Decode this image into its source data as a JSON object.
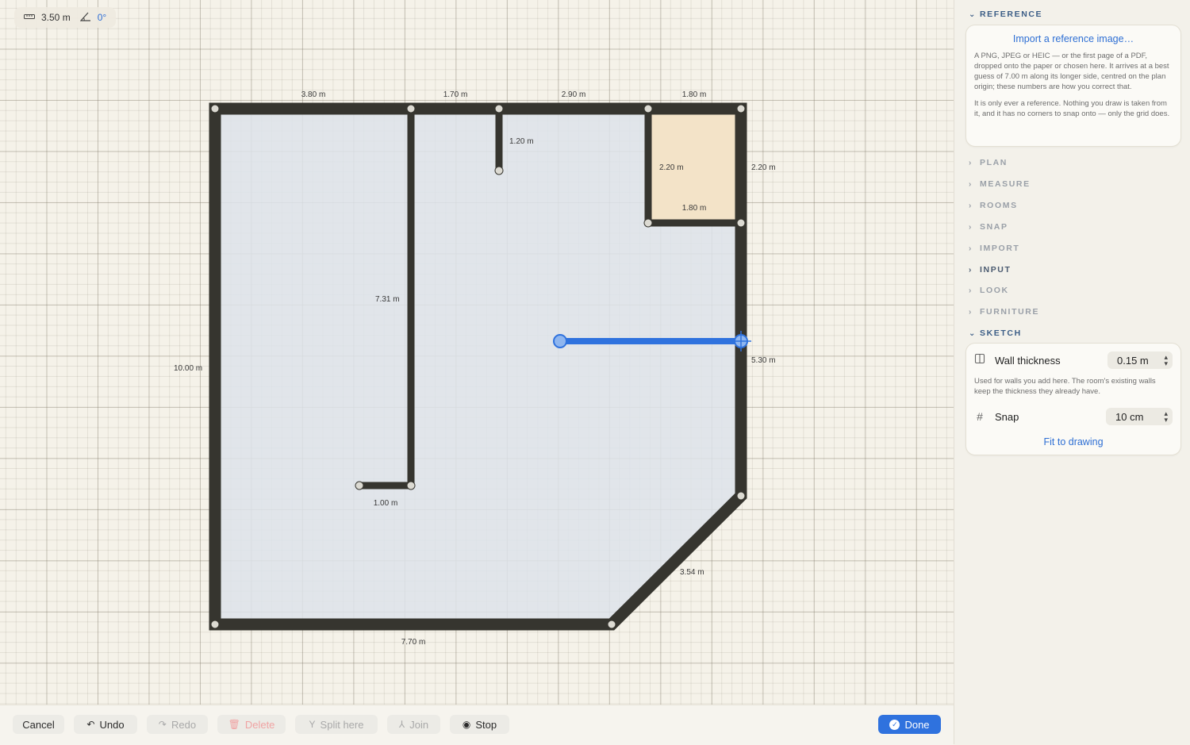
{
  "measure": {
    "length": "3.50 m",
    "angle": "0°"
  },
  "dimensions": {
    "top_1": "3.80 m",
    "top_2": "1.70 m",
    "top_3": "2.90 m",
    "top_4": "1.80 m",
    "stub": "1.20 m",
    "closet_height": "2.20 m",
    "right_upper": "2.20 m",
    "closet_width": "1.80 m",
    "inner_wall": "7.31 m",
    "left": "10.00 m",
    "right_lower": "5.30 m",
    "short_wall": "1.00 m",
    "diagonal": "3.54 m",
    "bottom": "7.70 m"
  },
  "sidebar": {
    "reference": {
      "title": "REFERENCE",
      "import_link": "Import a reference image…",
      "note1": "A PNG, JPEG or HEIC — or the first page of a PDF, dropped onto the paper or chosen here. It arrives at a best guess of 7.00 m along its longer side, centred on the plan origin; these numbers are how you correct that.",
      "note2": "It is only ever a reference. Nothing you draw is taken from it, and it has no corners to snap onto — only the grid does."
    },
    "sections": {
      "plan": "PLAN",
      "measure": "MEASURE",
      "rooms": "ROOMS",
      "snap": "SNAP",
      "import": "IMPORT",
      "input": "INPUT",
      "look": "LOOK",
      "furniture": "FURNITURE"
    },
    "sketch": {
      "title": "SKETCH",
      "wall_thickness_label": "Wall thickness",
      "wall_thickness_value": "0.15 m",
      "wall_note": "Used for walls you add here. The room's existing walls keep the thickness they already have.",
      "snap_label": "Snap",
      "snap_value": "10 cm",
      "fit_link": "Fit to drawing"
    }
  },
  "toolbar": {
    "cancel": "Cancel",
    "undo": "Undo",
    "redo": "Redo",
    "delete": "Delete",
    "split": "Split here",
    "join": "Join",
    "stop": "Stop",
    "done": "Done"
  },
  "colors": {
    "wall": "#36352f",
    "floor": "#dde3ea",
    "closet": "#f3e3c8",
    "accent": "#2f72de"
  }
}
